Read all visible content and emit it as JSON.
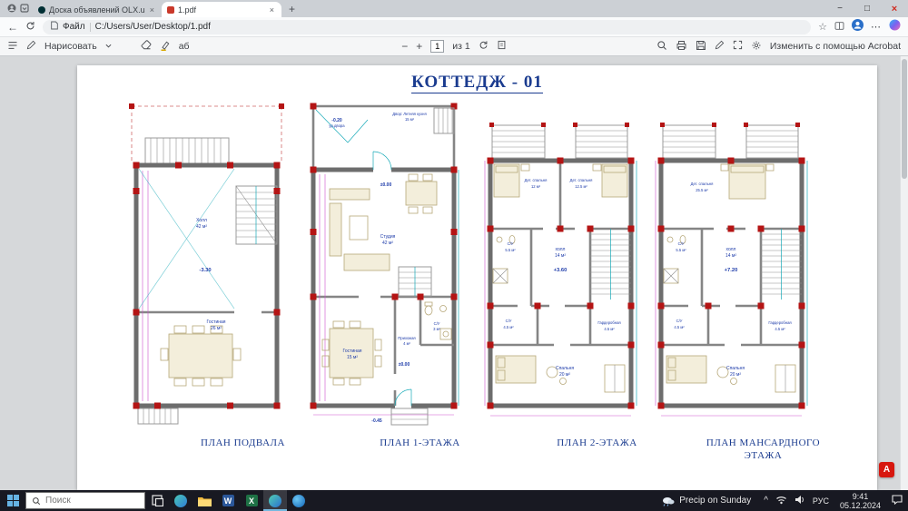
{
  "window": {
    "tabs": [
      {
        "title": "Доска объявлений OLX.uz, ран..."
      },
      {
        "title": "1.pdf"
      }
    ]
  },
  "navbar": {
    "file_badge": "Файл",
    "address": "C:/Users/User/Desktop/1.pdf"
  },
  "pdf_toolbar": {
    "draw_label": "Нарисовать",
    "read_aloud_label": "аб",
    "page_value": "1",
    "page_total": "из 1",
    "acrobat_label": "Изменить с помощью Acrobat"
  },
  "document": {
    "title": "КОТТЕДЖ - 01",
    "plans": [
      {
        "caption": "ПЛАН ПОДВАЛА",
        "labels": {
          "hall_name": "Холл",
          "hall_area": "42 м²",
          "level": "-3.30",
          "living_name": "Гостиная",
          "living_area": "26 м²"
        }
      },
      {
        "caption": "ПЛАН 1-ЭТАЖА",
        "labels": {
          "yard_level": "-0.20",
          "yard_name": "ур.двора",
          "summer_kitchen": "Двор: Летняя кухня",
          "summer_kitchen_area": "15 м²",
          "zero_top": "±0.00",
          "studio_name": "Студия",
          "studio_area": "42 м²",
          "entry_name": "Прихожая",
          "entry_area": "4 м²",
          "living_name": "Гостиная",
          "living_area": "15 м²",
          "zero_bottom": "±0.00",
          "wc_name": "С/У",
          "wc_area": "3 м²",
          "porch_level": "-0.45"
        }
      },
      {
        "caption": "ПЛАН 2-ЭТАЖА",
        "labels": {
          "kid1_name": "Дет. спальня",
          "kid1_area": "12 м²",
          "kid2_name": "Дет. спальня",
          "kid2_area": "12.5 м²",
          "wc1_name": "С/У",
          "wc1_area": "5.5 м²",
          "hall_name": "холл",
          "hall_area": "14 м²",
          "level": "+3.60",
          "wc2_name": "С/У",
          "wc2_area": "4.5 м²",
          "wardrobe_name": "Гардеробная",
          "wardrobe_area": "4.5 м²",
          "bedroom_name": "Спальня",
          "bedroom_area": "20 м²"
        }
      },
      {
        "caption": "ПЛАН МАНСАРДНОГО ЭТАЖА",
        "labels": {
          "kid1_name": "Дет. спальня",
          "kid1_area": "25.5 м²",
          "wc1_name": "С/У",
          "wc1_area": "5.5 м²",
          "hall_name": "холл",
          "hall_area": "14 м²",
          "level": "+7.20",
          "wc2_name": "С/У",
          "wc2_area": "4.5 м²",
          "wardrobe_name": "Гардеробная",
          "wardrobe_area": "4.5 м²",
          "bedroom_name": "Спальня",
          "bedroom_area": "20 м²"
        }
      }
    ]
  },
  "taskbar": {
    "search_placeholder": "Поиск",
    "weather": "Precip on Sunday",
    "lang": "РУС",
    "time": "9:41",
    "date": "05.12.2024"
  }
}
